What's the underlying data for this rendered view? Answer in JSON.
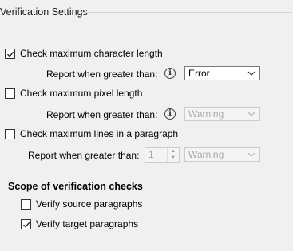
{
  "section": {
    "title": "Verification Settings"
  },
  "options": [
    {
      "label": "Check maximum character length",
      "checked": true,
      "report_label": "Report when greater than:",
      "select_value": "Error",
      "enabled": true
    },
    {
      "label": "Check maximum pixel length",
      "checked": false,
      "report_label": "Report when greater than:",
      "select_value": "Warning",
      "enabled": false
    },
    {
      "label": "Check maximum lines in a paragraph",
      "checked": false,
      "report_label": "Report when greater than:",
      "spin_value": "1",
      "select_value": "Warning",
      "enabled": false
    }
  ],
  "scope": {
    "title": "Scope of verification checks",
    "items": [
      {
        "label": "Verify source paragraphs",
        "checked": false
      },
      {
        "label": "Verify target paragraphs",
        "checked": true
      }
    ]
  },
  "icons": {
    "info": "info-icon",
    "dropdown": "chevron-down-icon",
    "check": "checkmark-icon"
  }
}
